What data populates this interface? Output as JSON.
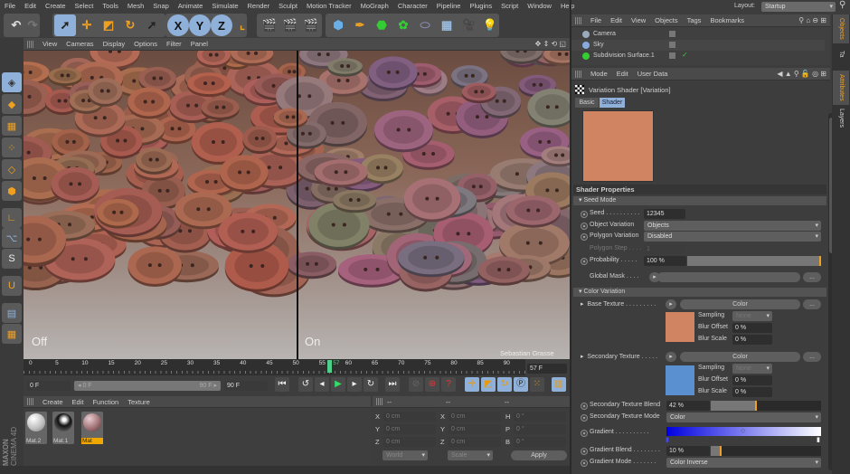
{
  "menu": [
    "File",
    "Edit",
    "Create",
    "Select",
    "Tools",
    "Mesh",
    "Snap",
    "Animate",
    "Simulate",
    "Render",
    "Sculpt",
    "Motion Tracker",
    "MoGraph",
    "Character",
    "Pipeline",
    "Plugins",
    "Script",
    "Window",
    "Help"
  ],
  "layout": {
    "label": "Layout:",
    "value": "Startup"
  },
  "viewport": {
    "menu": [
      "View",
      "Cameras",
      "Display",
      "Options",
      "Filter",
      "Panel"
    ],
    "left_label": "Off",
    "right_label": "On",
    "credit": "Sebastian Grasse"
  },
  "toolbar": {
    "x": "X",
    "y": "Y",
    "z": "Z"
  },
  "timeline": {
    "ticks": [
      "0",
      "5",
      "10",
      "15",
      "20",
      "25",
      "30",
      "35",
      "40",
      "45",
      "50",
      "55",
      "57",
      "60",
      "65",
      "70",
      "75",
      "80",
      "85",
      "90"
    ],
    "current": "57 F",
    "start": "0 F",
    "range_start": "0 F",
    "range_end": "90 F",
    "end": "90 F",
    "current_fraction": 0.633
  },
  "materials": {
    "menu": [
      "Create",
      "Edit",
      "Function",
      "Texture"
    ],
    "items": [
      "Mat.2",
      "Mat.1",
      "Mat"
    ]
  },
  "coords": {
    "header": [
      "--",
      "--",
      "--"
    ],
    "rows": [
      [
        "X",
        "0 cm",
        "X",
        "0 cm",
        "H",
        "0 °"
      ],
      [
        "Y",
        "0 cm",
        "Y",
        "0 cm",
        "P",
        "0 °"
      ],
      [
        "Z",
        "0 cm",
        "Z",
        "0 cm",
        "B",
        "0 °"
      ]
    ],
    "world": "World",
    "scale": "Scale",
    "apply": "Apply"
  },
  "brand": {
    "maxon": "MAXON",
    "product": "CINEMA 4D"
  },
  "objects": {
    "menu": [
      "File",
      "Edit",
      "View",
      "Objects",
      "Tags",
      "Bookmarks"
    ],
    "items": [
      "Camera",
      "Sky",
      "Subdivision Surface.1"
    ]
  },
  "side_tabs": [
    "Objects",
    "Ta",
    "Attributes",
    "Layers"
  ],
  "attributes": {
    "menu": [
      "Mode",
      "Edit",
      "User Data"
    ],
    "title": "Variation Shader [Variation]",
    "tabs": [
      "Basic",
      "Shader"
    ],
    "preview_color": "#d08462",
    "shader_properties": "Shader Properties",
    "seed_mode": "Seed Mode",
    "seed": {
      "label": "Seed",
      "value": "12345"
    },
    "object_variation": {
      "label": "Object Variation",
      "value": "Objects"
    },
    "polygon_variation": {
      "label": "Polygon Variation",
      "value": "Disabled"
    },
    "polygon_step": {
      "label": "Polygon Step",
      "value": "1"
    },
    "probability": {
      "label": "Probability",
      "value": "100 %",
      "fraction": 1.0
    },
    "global_mask": {
      "label": "Global Mask"
    },
    "color_variation": "Color Variation",
    "base_texture": {
      "label": "Base Texture",
      "value": "Color",
      "color": "#d08462",
      "sampling": "Sampling",
      "sampling_value": "None",
      "blur_offset": "Blur Offset",
      "blur_offset_value": "0 %",
      "blur_scale": "Blur Scale",
      "blur_scale_value": "0 %"
    },
    "secondary_texture": {
      "label": "Secondary Texture",
      "value": "Color",
      "color": "#5b90d0",
      "sampling": "Sampling",
      "sampling_value": "None",
      "blur_offset": "Blur Offset",
      "blur_offset_value": "0 %",
      "blur_scale": "Blur Scale",
      "blur_scale_value": "0 %"
    },
    "secondary_blend": {
      "label": "Secondary Texture Blend",
      "value": "42 %",
      "fraction": 0.42
    },
    "secondary_mode": {
      "label": "Secondary Texture Mode",
      "value": "Color"
    },
    "gradient": {
      "label": "Gradient"
    },
    "gradient_blend": {
      "label": "Gradient Blend",
      "value": "10 %",
      "fraction": 0.1
    },
    "gradient_mode": {
      "label": "Gradient Mode",
      "value": "Color Inverse"
    },
    "more": "..."
  }
}
